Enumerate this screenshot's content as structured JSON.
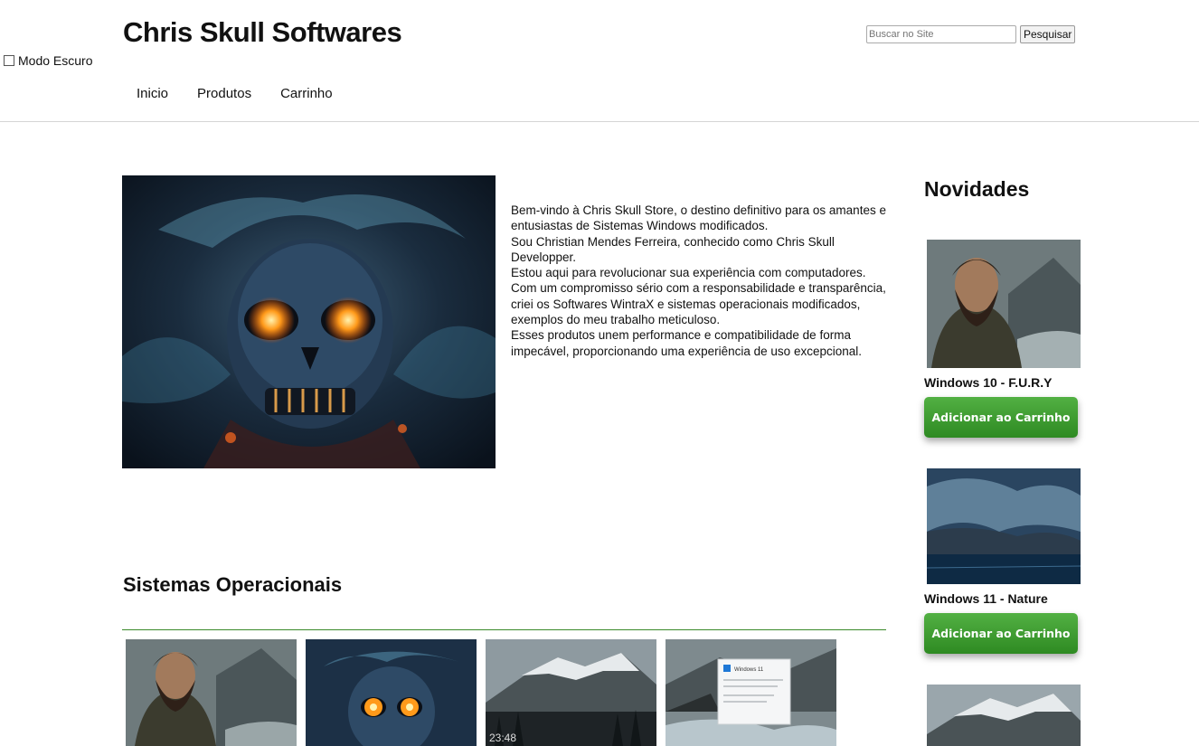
{
  "dark_mode": {
    "label": "Modo Escuro"
  },
  "header": {
    "brand": "Chris Skull Softwares",
    "nav": [
      "Inicio",
      "Produtos",
      "Carrinho"
    ]
  },
  "search": {
    "placeholder": "Buscar no Site",
    "button_label": "Pesquisar"
  },
  "hero": {
    "paragraphs": [
      "Bem-vindo à Chris Skull Store, o destino definitivo para os amantes e entusiastas de Sistemas Windows modificados.",
      "Sou Christian Mendes Ferreira, conhecido como Chris Skull Developper.",
      "Estou aqui para revolucionar sua experiência com computadores.",
      "Com um compromisso sério com a responsabilidade e transparência, criei os Softwares WintraX e sistemas operacionais modificados, exemplos do meu trabalho meticuloso.",
      "Esses produtos unem performance e compatibilidade de forma impecável, proporcionando uma experiência de uso excepcional."
    ]
  },
  "section": {
    "title": "Sistemas Operacionais"
  },
  "os_cards": [
    {
      "image": "bearded-man-photo"
    },
    {
      "image": "skull-art"
    },
    {
      "image": "snowy-mountain-photo",
      "time": "23:48"
    },
    {
      "image": "windows-11-dialog-landscape",
      "badge": "Windows 11"
    }
  ],
  "sidebar": {
    "title": "Novidades",
    "items": [
      {
        "name": "Windows 10 - F.U.R.Y",
        "button": "Adicionar ao Carrinho",
        "image": "bearded-man-photo"
      },
      {
        "name": "Windows 11 - Nature",
        "button": "Adicionar ao Carrinho",
        "image": "stormy-lake-photo"
      },
      {
        "image": "snowy-mountain-photo"
      }
    ]
  }
}
